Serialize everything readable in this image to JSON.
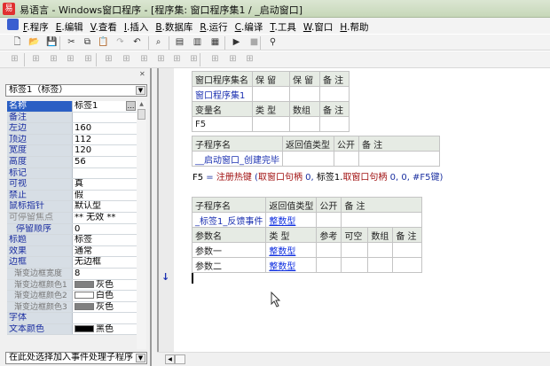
{
  "window": {
    "title": "易语言 - Windows窗口程序 - [程序集: 窗口程序集1 / _启动窗口]",
    "logo_text": "易"
  },
  "menu": [
    {
      "key": "F",
      "label": "程序"
    },
    {
      "key": "E",
      "label": "编辑"
    },
    {
      "key": "V",
      "label": "查看"
    },
    {
      "key": "I",
      "label": "插入"
    },
    {
      "key": "B",
      "label": "数据库"
    },
    {
      "key": "R",
      "label": "运行"
    },
    {
      "key": "C",
      "label": "编译"
    },
    {
      "key": "T",
      "label": "工具"
    },
    {
      "key": "W",
      "label": "窗口"
    },
    {
      "key": "H",
      "label": "帮助"
    }
  ],
  "toolbar1": [
    "new-icon",
    "open-icon",
    "save-icon",
    "cut-icon",
    "copy-icon",
    "paste-icon",
    "redo-icon",
    "undo-icon",
    "find-icon",
    "layout1-icon",
    "layout2-icon",
    "layout3-icon",
    "run-icon",
    "stop-icon",
    "binoculars-icon"
  ],
  "toolbar2": [
    "align-grid-icon",
    "align-left-icon",
    "align-right-icon",
    "align-top-icon",
    "align-bottom-icon",
    "center-h-icon",
    "center-v-icon",
    "space-h-icon",
    "space-v-icon",
    "distribute-h-icon",
    "distribute-v-icon",
    "same-width-icon",
    "same-height-icon",
    "same-size-icon"
  ],
  "properties": {
    "object_combo": "标签1（标签）",
    "rows": [
      {
        "name": "名称",
        "value": "标签1",
        "style": "sel"
      },
      {
        "name": "备注",
        "value": ""
      },
      {
        "name": "左边",
        "value": "160"
      },
      {
        "name": "顶边",
        "value": "112"
      },
      {
        "name": "宽度",
        "value": "120"
      },
      {
        "name": "高度",
        "value": "56"
      },
      {
        "name": "标记",
        "value": ""
      },
      {
        "name": "可视",
        "value": "真"
      },
      {
        "name": "禁止",
        "value": "假"
      },
      {
        "name": "鼠标指针",
        "value": "默认型"
      },
      {
        "name": "可停留焦点",
        "value": "** 无效 **",
        "style": "dim"
      },
      {
        "name": "停留顺序",
        "value": "0",
        "style": "sub2"
      },
      {
        "name": "标题",
        "value": "标签"
      },
      {
        "name": "效果",
        "value": "通常"
      },
      {
        "name": "边框",
        "value": "无边框"
      },
      {
        "name": "渐变边框宽度",
        "value": "8",
        "style": "sub"
      },
      {
        "name": "渐变边框颜色1",
        "value": "灰色",
        "style": "sub",
        "color": "#808080"
      },
      {
        "name": "渐变边框颜色2",
        "value": "白色",
        "style": "sub",
        "color": "#ffffff"
      },
      {
        "name": "渐变边框颜色3",
        "value": "灰色",
        "style": "sub",
        "color": "#808080"
      },
      {
        "name": "字体",
        "value": ""
      },
      {
        "name": "文本颜色",
        "value": "黑色",
        "color": "#000000"
      }
    ],
    "event_combo": "在此处选择加入事件处理子程序"
  },
  "editor": {
    "assembly_table": {
      "headers": [
        "窗口程序集名",
        "保 留",
        "保 留",
        "备 注"
      ],
      "row": [
        "窗口程序集1",
        "",
        "",
        ""
      ],
      "var_headers": [
        "变量名",
        "类 型",
        "数组",
        "备 注"
      ],
      "var_row": [
        "F5",
        "",
        "",
        ""
      ]
    },
    "sub1": {
      "headers": [
        "子程序名",
        "返回值类型",
        "公开",
        "备 注"
      ],
      "row": [
        "__启动窗口_创建完毕",
        "",
        "",
        ""
      ]
    },
    "code_line": {
      "var": "F5",
      "eq": " = ",
      "func": "注册热键",
      "p1": " (",
      "f2": "取窗口句柄",
      "a1": " 0,",
      "obj": " 标签1.",
      "f3": "取窗口句柄",
      "a2": " 0, 0, #F5键)"
    },
    "sub2": {
      "headers": [
        "子程序名",
        "返回值类型",
        "公开",
        "备 注"
      ],
      "row": [
        "_标签1_反馈事件",
        "整数型",
        "",
        ""
      ],
      "param_headers": [
        "参数名",
        "类 型",
        "参考",
        "可空",
        "数组",
        "备 注"
      ],
      "params": [
        [
          "参数一",
          "整数型",
          "",
          "",
          "",
          ""
        ],
        [
          "参数二",
          "整数型",
          "",
          "",
          "",
          ""
        ]
      ]
    }
  }
}
